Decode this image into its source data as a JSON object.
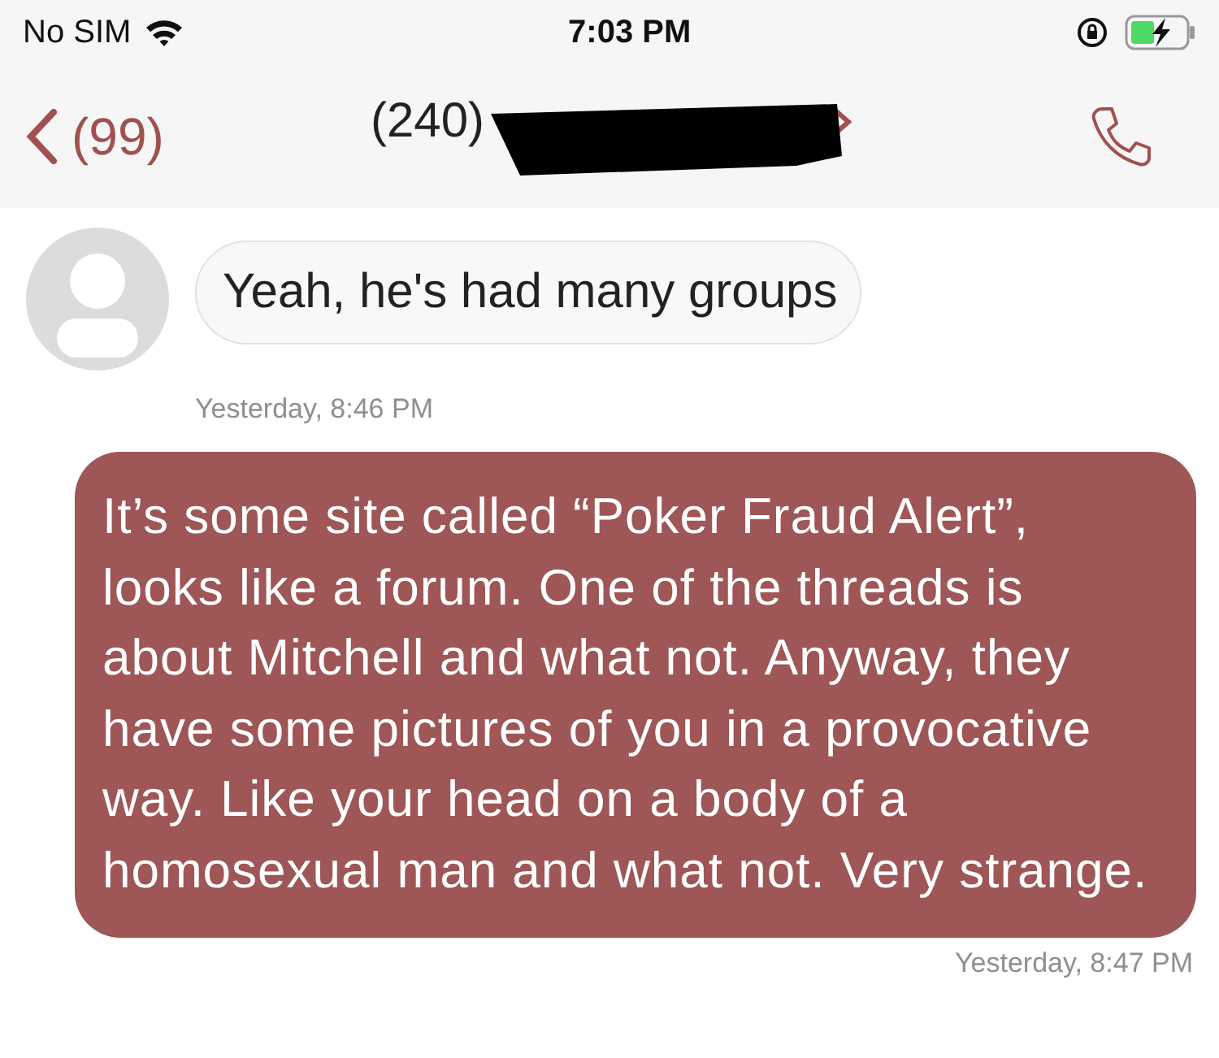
{
  "status_bar": {
    "carrier": "No SIM",
    "time": "7:03 PM",
    "battery_charging": true
  },
  "nav": {
    "back_count": "(99)",
    "contact": "(240)",
    "contact_redacted": true
  },
  "messages": [
    {
      "kind": "received",
      "text": "Yeah, he's had many groups",
      "timestamp": "Yesterday, 8:46 PM"
    },
    {
      "kind": "sent",
      "text": "It’s some site called “Poker Fraud Alert”, looks like a forum. One of the threads is about Mitchell and what not. Anyway, they have some pictures of you in a provocative way. Like your head on a body of a homosexual man and what not. Very strange.",
      "timestamp": "Yesterday, 8:47 PM"
    }
  ]
}
